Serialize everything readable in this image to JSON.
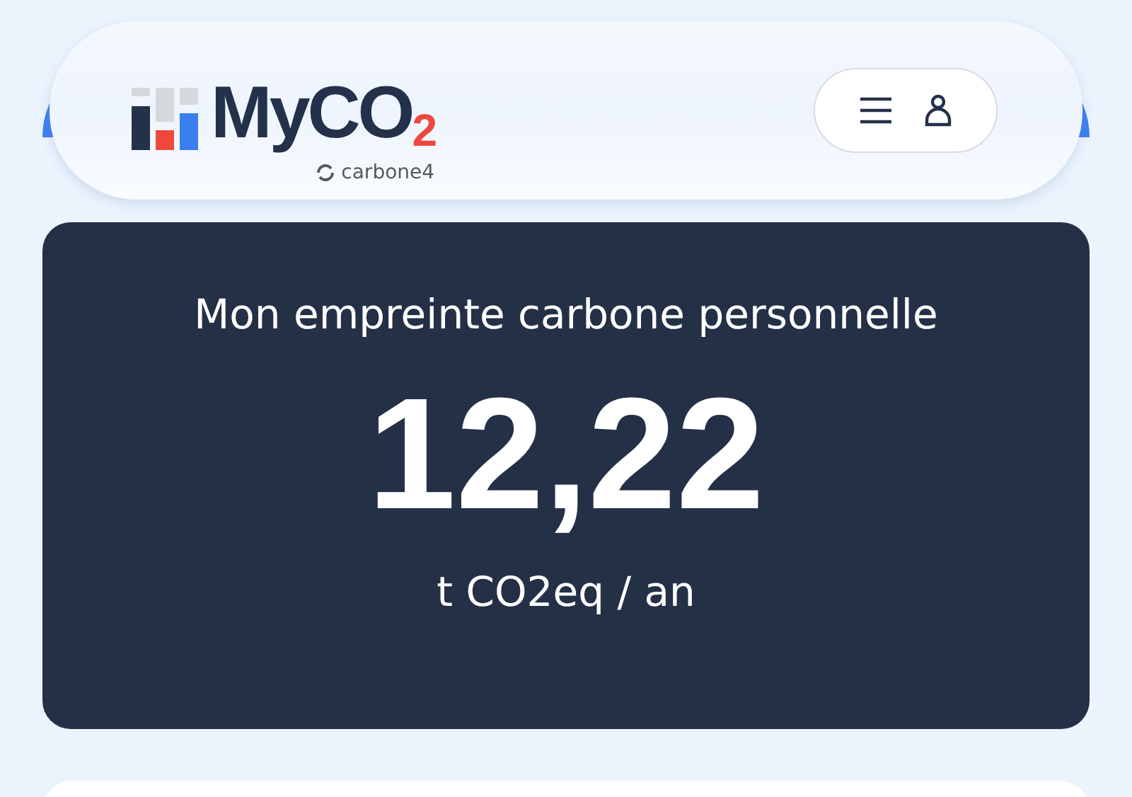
{
  "header": {
    "logo": "MyCO$_{2}$",
    "logo_subtitle": "carbone4"
  },
  "summary": {
    "title": "Mon empreinte carbone personnelle",
    "value": "12,22",
    "unit": "t CO2eq / an"
  }
}
